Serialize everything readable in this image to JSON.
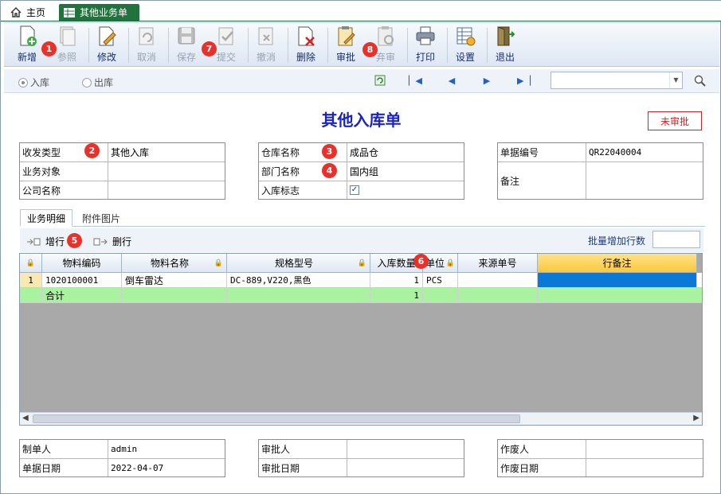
{
  "tabs": {
    "home": "主页",
    "active": "其他业务单"
  },
  "toolbar": {
    "add": "新增",
    "reference": "参照",
    "edit": "修改",
    "cancel": "取消",
    "save": "保存",
    "submit": "提交",
    "revoke": "撤消",
    "delete": "删除",
    "approve": "审批",
    "abandon": "弃审",
    "print": "打印",
    "settings": "设置",
    "exit": "退出"
  },
  "badges": [
    "1",
    "2",
    "3",
    "4",
    "5",
    "6",
    "7",
    "8"
  ],
  "nav": {
    "radio_in": "入库",
    "radio_out": "出库",
    "selected": "入库",
    "combo_value": ""
  },
  "form": {
    "title": "其他入库单",
    "status": "未审批",
    "left": {
      "type_label": "收发类型",
      "type_value": "其他入库",
      "object_label": "业务对象",
      "object_value": "",
      "company_label": "公司名称",
      "company_value": ""
    },
    "mid": {
      "warehouse_label": "仓库名称",
      "warehouse_value": "成品仓",
      "dept_label": "部门名称",
      "dept_value": "国内组",
      "flag_label": "入库标志",
      "flag_checked": true
    },
    "right": {
      "docno_label": "单据编号",
      "docno_value": "QR22040004",
      "remark_label": "备注",
      "remark_value": ""
    }
  },
  "subtabs": {
    "detail": "业务明细",
    "attach": "附件图片"
  },
  "rowtools": {
    "add_row": "增行",
    "del_row": "删行",
    "batch_label": "批量增加行数",
    "batch_value": ""
  },
  "grid": {
    "columns": [
      "物料编码",
      "物料名称",
      "规格型号",
      "入库数量",
      "单位",
      "来源单号",
      "行备注"
    ],
    "rows": [
      {
        "no": "1",
        "code": "1020100001",
        "name": "倒车雷达",
        "spec": "DC-889,V220,黑色",
        "qty": "1",
        "unit": "PCS",
        "src": "",
        "remark": ""
      }
    ],
    "total": {
      "label": "合计",
      "qty": "1"
    }
  },
  "footer": {
    "maker_label": "制单人",
    "maker_value": "admin",
    "date_label": "单据日期",
    "date_value": "2022-04-07",
    "approver_label": "审批人",
    "approver_value": "",
    "approve_date_label": "审批日期",
    "approve_date_value": "",
    "voider_label": "作废人",
    "voider_value": "",
    "void_date_label": "作废日期",
    "void_date_value": ""
  },
  "colors": {
    "accent": "#21733e",
    "title": "#1a23c9",
    "badge": "#e8312b",
    "selected_cell": "#0a78d7",
    "total_row": "#a8f2a0"
  }
}
